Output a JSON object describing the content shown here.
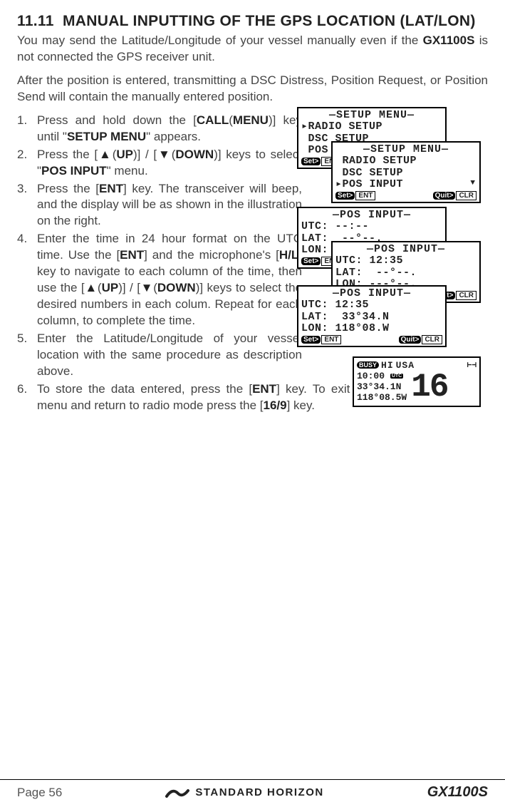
{
  "section": {
    "number": "11.11",
    "title": "MANUAL INPUTTING OF THE GPS LOCATION",
    "title_suffix": "(LAT/LON)"
  },
  "intro": {
    "p1a": "You may send the Latitude/Longitude of your vessel manually even if the ",
    "p1_model": "GX1100S",
    "p1b": " is not connected the GPS receiver unit.",
    "p2": "After the position is entered, transmitting a DSC Distress, Position Request, or Position Send will contain the manually entered position."
  },
  "steps": [
    {
      "num": "1.",
      "html": "Press and hold down the [<b>CALL</b>(<b>MENU</b>)] key until \"<b>SETUP MENU</b>\" appears."
    },
    {
      "num": "2.",
      "html": "Press the [<b>▲</b>(<b>UP</b>)] / [<b>▼</b>(<b>DOWN</b>)] keys to select \"<b>POS INPUT</b>\" menu."
    },
    {
      "num": "3.",
      "html": "Press the [<b>ENT</b>] key. The transceiver will beep, and the display will be as shown in the illustration on the right."
    },
    {
      "num": "4.",
      "html": "Enter the time in 24 hour format on the UTC time. Use the [<b>ENT</b>] and the microphone's [<b>H/L</b>] key to navigate to each column of the time, then use the [<b>▲</b>(<b>UP</b>)] / [<b>▼</b>(<b>DOWN</b>)] keys to select the desired numbers in each colum. Repeat for each column, to complete the time."
    },
    {
      "num": "5.",
      "html": "Enter the Latitude/Longitude of your vessel location with the same procedure as description above."
    },
    {
      "num": "6.",
      "html": "To store the data entered, press the [<b>ENT</b>] key. To exit this menu and return to radio mode press the [<b>16/9</b>] key."
    }
  ],
  "lcd_screens": {
    "setup1": {
      "title": "—SETUP MENU—",
      "lines": [
        "▸RADIO SETUP",
        " DSC SETUP",
        " POS INPUT"
      ],
      "set": "Set>",
      "ent": "ENT",
      "quit": "Quit>",
      "clr": "CLR"
    },
    "setup2": {
      "title": "—SETUP MENU—",
      "lines": [
        " RADIO SETUP",
        " DSC SETUP",
        "▸POS INPUT"
      ],
      "set": "Set>",
      "ent": "ENT",
      "quit": "Quit>",
      "clr": "CLR"
    },
    "pos1": {
      "title": "—POS INPUT—",
      "utc": "UTC: --:--",
      "lat": "LAT:  --°--.",
      "lon": "LON: ---°--.",
      "set": "Set>",
      "ent": "ENT",
      "quit": "Quit>",
      "clr": "CLR"
    },
    "pos2": {
      "title": "—POS INPUT—",
      "utc": "UTC: 12:35",
      "lat": "LAT:  --°--.",
      "lon": "LON: ---°--.",
      "set": "Set>",
      "ent": "ENT",
      "quit": "Quit>",
      "clr": "CLR"
    },
    "pos3": {
      "title": "—POS INPUT—",
      "utc": "UTC: 12:35",
      "lat": "LAT:  33°34.N",
      "lon": "LON: 118°08.W",
      "set": "Set>",
      "ent": "ENT",
      "quit": "Quit>",
      "clr": "CLR"
    }
  },
  "radio": {
    "busy": "BUSY",
    "hi": "HI",
    "usa": "USA",
    "time": "10:00",
    "utc_badge": "UTC",
    "lat": "33°34.1N",
    "lon": "118°08.5W",
    "channel": "16"
  },
  "footer": {
    "page": "Page 56",
    "brand": "STANDARD HORIZON",
    "model": "GX1100S"
  }
}
